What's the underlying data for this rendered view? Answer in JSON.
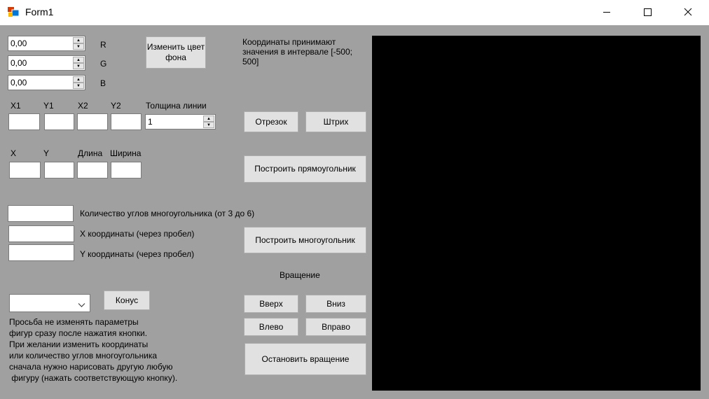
{
  "window": {
    "title": "Form1"
  },
  "color": {
    "r_value": "0,00",
    "g_value": "0,00",
    "b_value": "0,00",
    "r_label": "R",
    "g_label": "G",
    "b_label": "B",
    "change_bg_button": "Изменить цвет фона"
  },
  "info": {
    "coords_note": "Координаты принимают значения в интервале [-500; 500]"
  },
  "segment": {
    "x1_label": "X1",
    "y1_label": "Y1",
    "x2_label": "X2",
    "y2_label": "Y2",
    "x1_value": "",
    "y1_value": "",
    "x2_value": "",
    "y2_value": "",
    "thickness_label": "Толщина линии",
    "thickness_value": "1",
    "segment_button": "Отрезок",
    "dash_button": "Штрих"
  },
  "rect": {
    "x_label": "X",
    "y_label": "Y",
    "length_label": "Длина",
    "width_label": "Ширина",
    "x_value": "",
    "y_value": "",
    "length_value": "",
    "width_value": "",
    "build_button": "Построить прямоугольник"
  },
  "polygon": {
    "corners_value": "",
    "corners_label": "Количество углов многоугольника (от 3 до 6)",
    "x_value": "",
    "x_label": "X координаты (через пробел)",
    "y_value": "",
    "y_label": "Y координаты (через пробел)",
    "build_button": "Построить многоугольник"
  },
  "rotation": {
    "title": "Вращение",
    "up_button": "Вверх",
    "down_button": "Вниз",
    "left_button": "Влево",
    "right_button": "Вправо",
    "stop_button": "Остановить вращение"
  },
  "cone": {
    "select_value": "",
    "button": "Конус"
  },
  "note": {
    "line1": "Просьба не изменять параметры",
    "line2": "фигур сразу после нажатия кнопки.",
    "line3": "При желании изменить координаты",
    "line4": "или количество углов многоугольника",
    "line5": "сначала нужно нарисовать другую любую",
    "line6": " фигуру (нажать соответствующую кнопку)."
  },
  "colors": {
    "form_bg": "#a0a0a0",
    "canvas_bg": "#000000",
    "button_bg": "#e1e1e1"
  }
}
